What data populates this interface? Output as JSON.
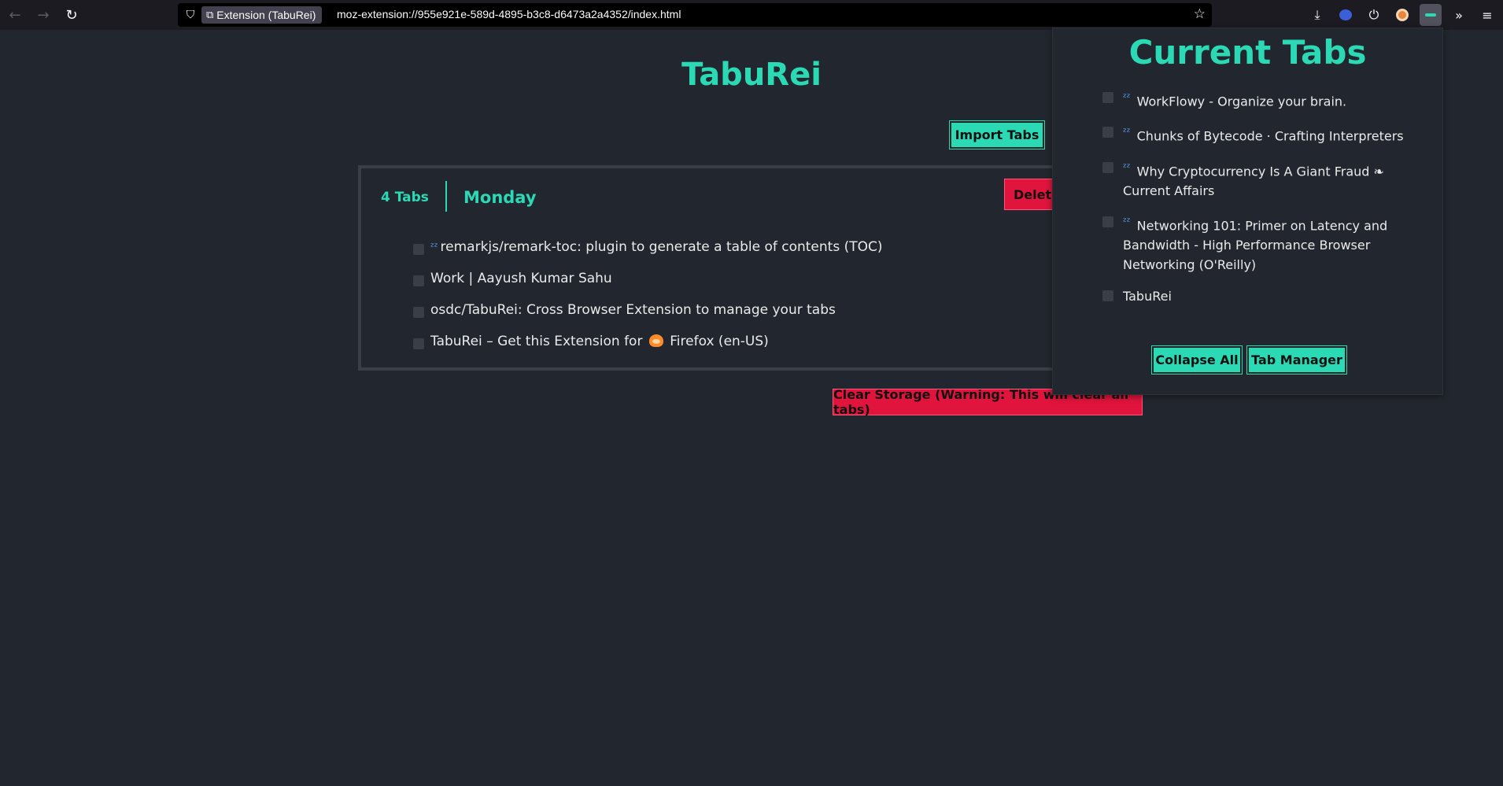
{
  "browser": {
    "identity_label": "Extension (TabuRei)",
    "url": "moz-extension://955e921e-589d-4895-b3c8-d6473a2a4352/index.html"
  },
  "page": {
    "title": "TabuRei",
    "import_label": "Import Tabs",
    "clear_label": "Clear Storage (Warning: This will clear all tabs)",
    "group": {
      "count_label": "4 Tabs",
      "name": "Monday",
      "delete_label": "Delete",
      "tabs": [
        {
          "title": "remarkjs/remark-toc: plugin to generate a table of contents (TOC)",
          "sleeping": true
        },
        {
          "title": "Work | Aayush Kumar Sahu",
          "sleeping": false
        },
        {
          "title": "osdc/TabuRei: Cross Browser Extension to manage your tabs",
          "sleeping": false
        },
        {
          "title_before": "TabuRei – Get this Extension for",
          "title_after": "Firefox (en-US)",
          "sleeping": false
        }
      ]
    }
  },
  "popup": {
    "title": "Current Tabs",
    "tabs": [
      {
        "title": "WorkFlowy - Organize your brain.",
        "sleeping": true
      },
      {
        "title": "Chunks of Bytecode · Crafting Interpreters",
        "sleeping": true
      },
      {
        "title": "Why Cryptocurrency Is A Giant Fraud ❧ Current Affairs",
        "sleeping": true
      },
      {
        "title": "Networking 101: Primer on Latency and Bandwidth - High Performance Browser Networking (O'Reilly)",
        "sleeping": true
      },
      {
        "title": "TabuRei",
        "sleeping": false
      }
    ],
    "collapse_label": "Collapse All",
    "manager_label": "Tab Manager"
  },
  "sleep_marker": "ᶻᶻ",
  "colors": {
    "accent": "#2bd9b5",
    "danger": "#e0143c",
    "background": "#22272f"
  }
}
